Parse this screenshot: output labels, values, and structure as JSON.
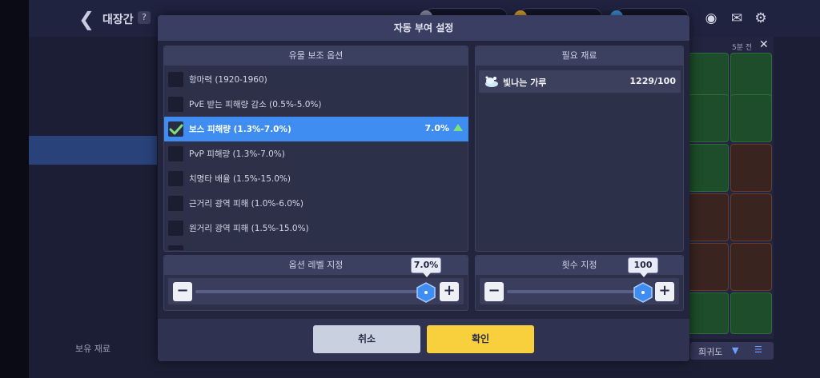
{
  "background": {
    "screen_title": "대장간",
    "help_label": "?",
    "owned_material_label": "보유 재료",
    "sort_label": "희귀도",
    "tier_label": "5분 전"
  },
  "dialog": {
    "title": "자동 부여 설정",
    "options_panel": {
      "header": "유물 보조 옵션",
      "options": [
        {
          "label": "항마력 (1920-1960)",
          "checked": false,
          "value": ""
        },
        {
          "label": "PvE 받는 피해량 감소 (0.5%-5.0%)",
          "checked": false,
          "value": ""
        },
        {
          "label": "보스 피해량 (1.3%-7.0%)",
          "checked": true,
          "value": "7.0%"
        },
        {
          "label": "PvP 피해량 (1.3%-7.0%)",
          "checked": false,
          "value": ""
        },
        {
          "label": "치명타 배율 (1.5%-15.0%)",
          "checked": false,
          "value": ""
        },
        {
          "label": "근거리 광역 피해 (1.0%-6.0%)",
          "checked": false,
          "value": ""
        },
        {
          "label": "원거리 광역 피해 (1.5%-15.0%)",
          "checked": false,
          "value": ""
        }
      ]
    },
    "materials_panel": {
      "header": "필요 재료",
      "items": [
        {
          "name": "빛나는 가루",
          "count": "1229/100",
          "icon": "glowing-powder-icon"
        }
      ]
    },
    "level_panel": {
      "header": "옵션 레벨 지정",
      "value_label": "7.0%",
      "level_fraction": 1.0
    },
    "count_panel": {
      "header": "횟수 지정",
      "value_label": "100",
      "level_fraction": 1.0
    },
    "cancel_label": "취소",
    "confirm_label": "확인"
  },
  "colors": {
    "accent_blue": "#3f8df0",
    "confirm_yellow": "#f8cf3c",
    "cancel_gray": "#c9d1e0",
    "check_green": "#7de07a"
  }
}
